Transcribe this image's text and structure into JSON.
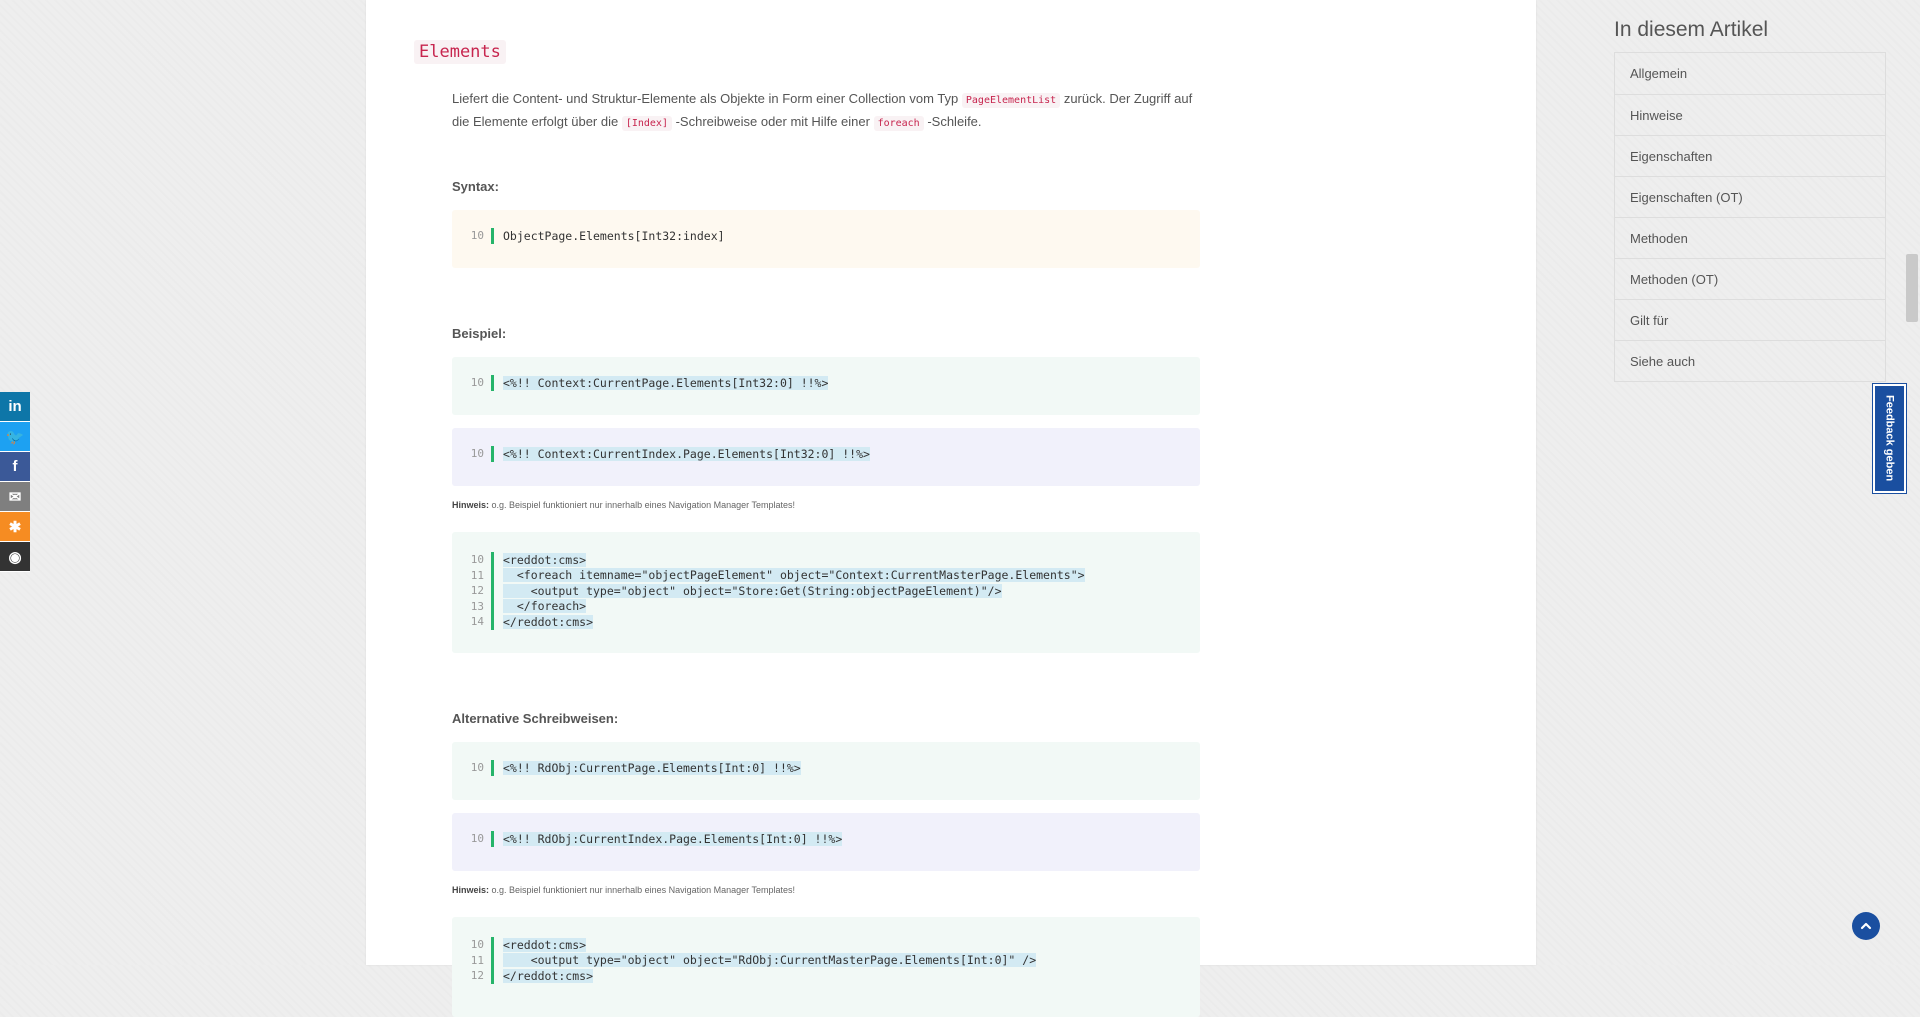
{
  "section": {
    "title": "Elements"
  },
  "description": {
    "part1": "Liefert die Content- und Struktur-Elemente als Objekte in Form einer Collection vom Typ ",
    "code1": "PageElementList",
    "part2": " zurück. Der Zugriff auf die Elemente erfolgt über die ",
    "code2": "[Index]",
    "part3": " -Schreibweise oder mit Hilfe einer ",
    "code3": "foreach",
    "part4": " -Schleife."
  },
  "syntax": {
    "label": "Syntax:",
    "lines": [
      {
        "n": "10",
        "code": "ObjectPage.Elements[Int32:index]"
      }
    ]
  },
  "beispiel": {
    "label": "Beispiel:",
    "block1": [
      {
        "n": "10",
        "code": "<%!! Context:CurrentPage.Elements[Int32:0] !!%>"
      }
    ],
    "block2": [
      {
        "n": "10",
        "code": "<%!! Context:CurrentIndex.Page.Elements[Int32:0] !!%>"
      }
    ],
    "hint_label": "Hinweis:",
    "hint_text": " o.g. Beispiel funktioniert nur innerhalb eines Navigation Manager Templates!",
    "block3": [
      {
        "n": "10",
        "code": "<reddot:cms>"
      },
      {
        "n": "11",
        "code": "  <foreach itemname=\"objectPageElement\" object=\"Context:CurrentMasterPage.Elements\">"
      },
      {
        "n": "12",
        "code": "    <output type=\"object\" object=\"Store:Get(String:objectPageElement)\"/>"
      },
      {
        "n": "13",
        "code": "  </foreach>"
      },
      {
        "n": "14",
        "code": "</reddot:cms>"
      }
    ]
  },
  "alternative": {
    "label": "Alternative Schreibweisen:",
    "block1": [
      {
        "n": "10",
        "code": "<%!! RdObj:CurrentPage.Elements[Int:0] !!%>"
      }
    ],
    "block2": [
      {
        "n": "10",
        "code": "<%!! RdObj:CurrentIndex.Page.Elements[Int:0] !!%>"
      }
    ],
    "hint_label": "Hinweis:",
    "hint_text": " o.g. Beispiel funktioniert nur innerhalb eines Navigation Manager Templates!",
    "block3": [
      {
        "n": "10",
        "code": "<reddot:cms>"
      },
      {
        "n": "11",
        "code": "    <output type=\"object\" object=\"RdObj:CurrentMasterPage.Elements[Int:0]\" />"
      },
      {
        "n": "12",
        "code": "</reddot:cms>"
      }
    ]
  },
  "toc": {
    "title": "In diesem Artikel",
    "items": [
      "Allgemein",
      "Hinweise",
      "Eigenschaften",
      "Eigenschaften (OT)",
      "Methoden",
      "Methoden (OT)",
      "Gilt für",
      "Siehe auch"
    ]
  },
  "social": [
    {
      "icon": "linkedin-icon",
      "glyph": "in",
      "color": "#0e76a8"
    },
    {
      "icon": "twitter-icon",
      "glyph": "🐦",
      "color": "#1da1f2"
    },
    {
      "icon": "facebook-icon",
      "glyph": "f",
      "color": "#3b5998"
    },
    {
      "icon": "email-icon",
      "glyph": "✉",
      "color": "#7f7f7f"
    },
    {
      "icon": "share-icon",
      "glyph": "✱",
      "color": "#f68c22"
    },
    {
      "icon": "github-icon",
      "glyph": "◉",
      "color": "#333333"
    }
  ],
  "feedback": {
    "label": "Feedback geben"
  },
  "colors": {
    "accent": "#1a4fa0",
    "code_bar": "#26b46a",
    "inline_code": "#c7254e"
  }
}
